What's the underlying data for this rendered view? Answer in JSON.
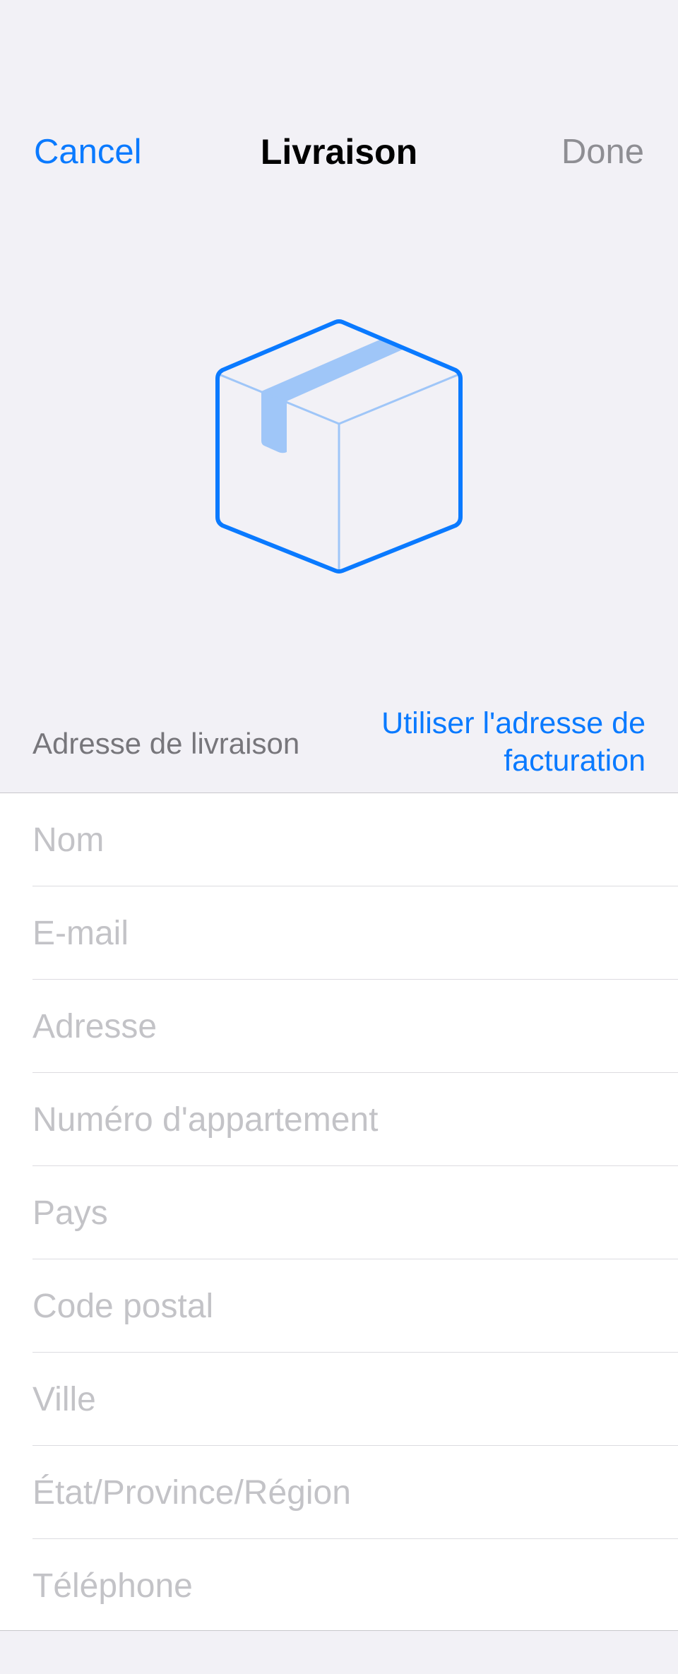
{
  "nav": {
    "cancel_label": "Cancel",
    "title": "Livraison",
    "done_label": "Done"
  },
  "hero": {
    "icon": "package-box-icon",
    "accent_color": "#0a7aff",
    "tape_color": "#9fc6f8"
  },
  "section": {
    "label": "Adresse de livraison",
    "billing_link": "Utiliser l'adresse de facturation"
  },
  "form": {
    "fields": [
      {
        "placeholder": "Nom",
        "value": ""
      },
      {
        "placeholder": "E-mail",
        "value": ""
      },
      {
        "placeholder": "Adresse",
        "value": ""
      },
      {
        "placeholder": "Numéro d'appartement",
        "value": ""
      },
      {
        "placeholder": "Pays",
        "value": ""
      },
      {
        "placeholder": "Code postal",
        "value": ""
      },
      {
        "placeholder": "Ville",
        "value": ""
      },
      {
        "placeholder": "État/Province/Région",
        "value": ""
      },
      {
        "placeholder": "Téléphone",
        "value": ""
      }
    ]
  }
}
